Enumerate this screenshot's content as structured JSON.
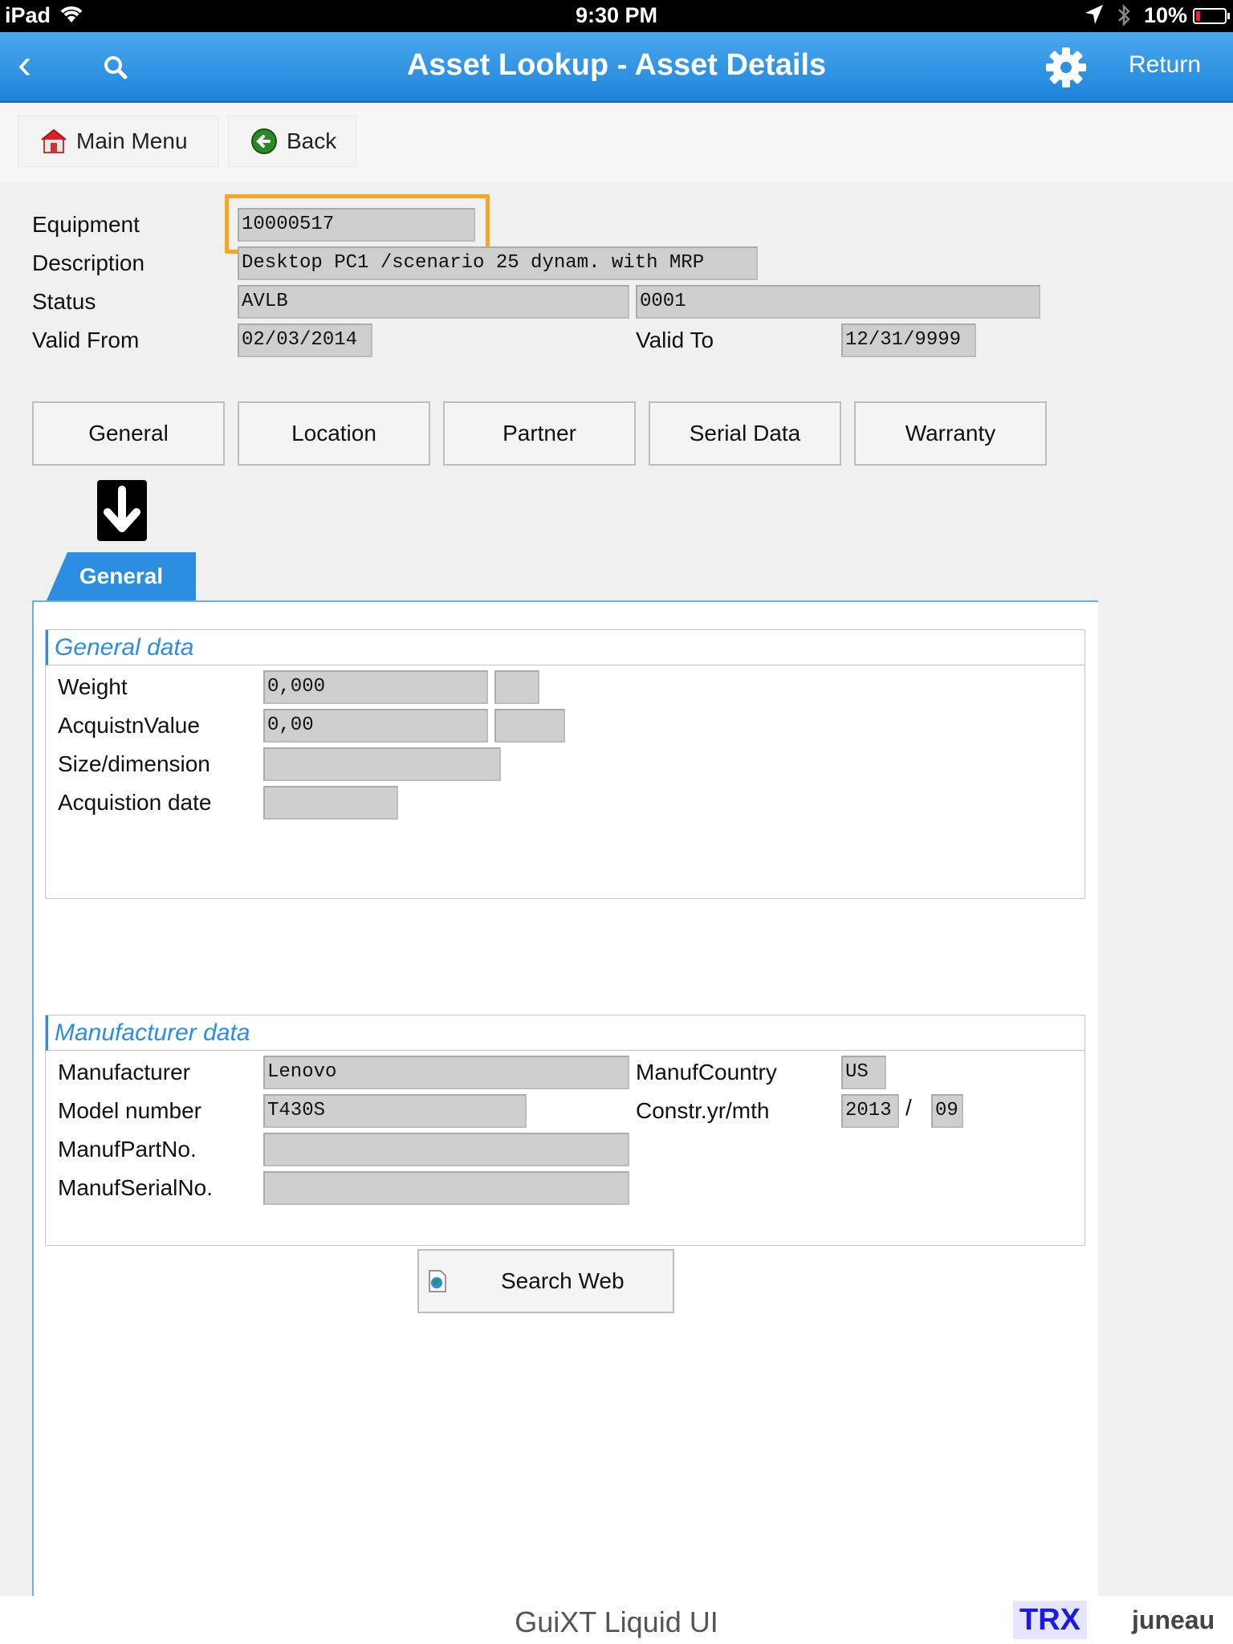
{
  "status_bar": {
    "carrier": "iPad",
    "time": "9:30 PM",
    "battery": "10%"
  },
  "nav": {
    "title": "Asset Lookup - Asset Details",
    "return_label": "Return"
  },
  "toolbar": {
    "main_menu_label": "Main Menu",
    "back_label": "Back"
  },
  "header_fields": {
    "equipment_label": "Equipment",
    "equipment_value": "10000517",
    "description_label": "Description",
    "description_value": "Desktop PC1 /scenario 25 dynam. with MRP",
    "status_label": "Status",
    "status_value": "AVLB",
    "status_code": "0001",
    "valid_from_label": "Valid From",
    "valid_from_value": "02/03/2014",
    "valid_to_label": "Valid To",
    "valid_to_value": "12/31/9999"
  },
  "tabs": [
    {
      "label": "General"
    },
    {
      "label": "Location"
    },
    {
      "label": "Partner"
    },
    {
      "label": "Serial Data"
    },
    {
      "label": "Warranty"
    }
  ],
  "active_tab": "General",
  "general_data": {
    "title": "General data",
    "weight_label": "Weight",
    "weight_value": "0,000",
    "weight_unit": "",
    "acq_value_label": "AcquistnValue",
    "acq_value_value": "0,00",
    "acq_value_currency": "",
    "size_label": "Size/dimension",
    "size_value": "",
    "acq_date_label": "Acquistion date",
    "acq_date_value": ""
  },
  "manufacturer_data": {
    "title": "Manufacturer data",
    "manufacturer_label": "Manufacturer",
    "manufacturer_value": "Lenovo",
    "country_label": "ManufCountry",
    "country_value": "US",
    "model_label": "Model number",
    "model_value": "T430S",
    "constr_label": "Constr.yr/mth",
    "constr_year": "2013",
    "constr_sep": "/",
    "constr_month": "09",
    "part_label": "ManufPartNo.",
    "part_value": "",
    "serial_label": "ManufSerialNo.",
    "serial_value": ""
  },
  "search_web_label": "Search Web",
  "footer": {
    "brand": "GuiXT Liquid UI",
    "trx": "TRX",
    "user": "juneau"
  },
  "colors": {
    "nav_blue": "#2b8ee0",
    "highlight_orange": "#f5a623",
    "field_gray": "#cfcfcf"
  }
}
